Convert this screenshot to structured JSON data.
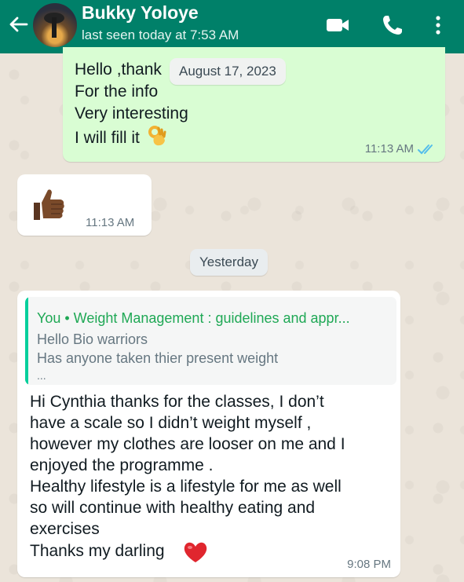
{
  "header": {
    "contact_name": "Bukky Yoloye",
    "status": "last seen today at 7:53 AM",
    "icons": [
      "back-arrow-icon",
      "video-call-icon",
      "voice-call-icon",
      "more-options-icon"
    ],
    "color": "#008069"
  },
  "date_pill": "August 17, 2023",
  "outgoing_message": {
    "lines": [
      "Hello ,thank",
      "For the info",
      "Very interesting",
      "I will fill it"
    ],
    "emoji": "ok-hand-icon",
    "time": "11:13 AM",
    "status_icon": "double-check-read-icon"
  },
  "incoming_message_1": {
    "emoji": "thumbs-up-icon",
    "time": "11:13 AM"
  },
  "yesterday_pill": "Yesterday",
  "incoming_message_2": {
    "quote": {
      "title": "You • Weight Management : guidelines and appr...",
      "line1": "Hello Bio warriors",
      "line2": "Has anyone taken thier present weight",
      "line3": "..."
    },
    "lines": [
      "Hi Cynthia thanks for the classes, I don’t",
      "have a scale so I didn’t weight myself ,",
      "however my clothes are looser on me and  I",
      "enjoyed the programme .",
      "Healthy lifestyle is a lifestyle for me as well",
      "so will continue with healthy eating and",
      "exercises"
    ],
    "closing": "Thanks my darling",
    "emoji": "red-heart-icon",
    "time": "9:08 PM"
  }
}
